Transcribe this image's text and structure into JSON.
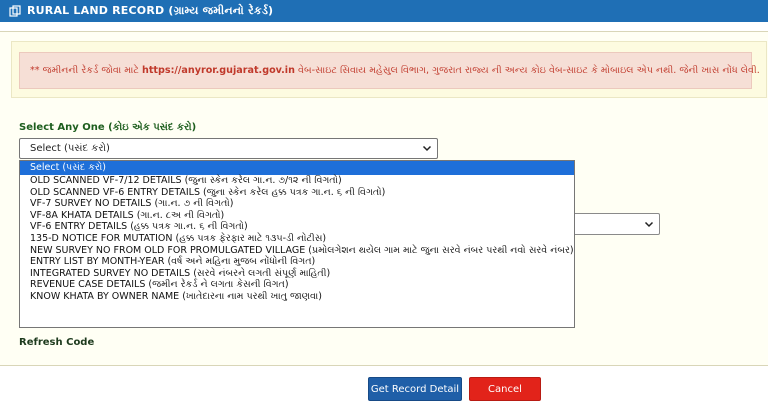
{
  "header": {
    "title": "RURAL LAND RECORD (ગ્રામ્ય જમીનનો રેકર્ડ)",
    "icon": "copy-icon"
  },
  "notice": {
    "prefix": "** જમીનની રેકર્ડ જોવા માટે",
    "url": "https://anyror.gujarat.gov.in",
    "suffix": "વેબ-સાઇટ સિવાય મહેસુલ વિભાગ, ગુજરાત રાજ્ય ની અન્ય કોઇ વેબ-સાઇટ કે મોબાઇલ એપ નથી. જેની ખાસ નોંધ લેવી."
  },
  "form": {
    "select_label": "Select Any One (કોઇ એક પસંદ કરો)",
    "selected_value": "Select (પસંદ કરો)",
    "options": [
      "Select (પસંદ કરો)",
      "OLD SCANNED VF-7/12 DETAILS (જુના સ્કેન કરેલ ગા.ન. ૭/૧૨ ની વિગતો)",
      "OLD SCANNED VF-6 ENTRY DETAILS (જુના સ્કેન કરેલ હક્ક પત્રક ગા.ન. ૬ ની વિગતો)",
      "VF-7 SURVEY NO DETAILS (ગા.ન. ૭ ની વિગતો)",
      "VF-8A KHATA DETAILS (ગા.ન. ૮અ ની વિગતો)",
      "VF-6 ENTRY DETAILS (હક્ક પત્રક ગા.ન. ૬ ની વિગતો)",
      "135-D NOTICE FOR MUTATION (હક્ક પત્રક ફેરફાર માટે ૧૩૫-ડી નોટીસ)",
      "NEW SURVEY NO FROM OLD FOR PROMULGATED VILLAGE (પ્રમોલગેશન થયેલ ગામ માટે જુના સરવે નંબર પરથી નવો સરવે નંબર)",
      "ENTRY LIST BY MONTH-YEAR (વર્ષ અને મહિના મુજબ નોંધોની વિગત)",
      "INTEGRATED SURVEY NO DETAILS (સરવે નંબરને લગતી સંપૂર્ણ માહિતી)",
      "REVENUE CASE DETAILS (જમીન રેકર્ડ ને લગતા કેસની વિગત)",
      "KNOW KHATA BY OWNER NAME (ખાતેદારના નામ પરથી ખાતુ જાણવા)"
    ],
    "refresh_label": "Refresh Code"
  },
  "buttons": {
    "get_record": "Get Record Detail",
    "cancel": "Cancel"
  },
  "colors": {
    "header_bg": "#1f6fb5",
    "notice_text": "#c0392b",
    "primary_button": "#1f5fa8",
    "cancel_button": "#e2231a",
    "selected_option": "#1e6fd9"
  }
}
